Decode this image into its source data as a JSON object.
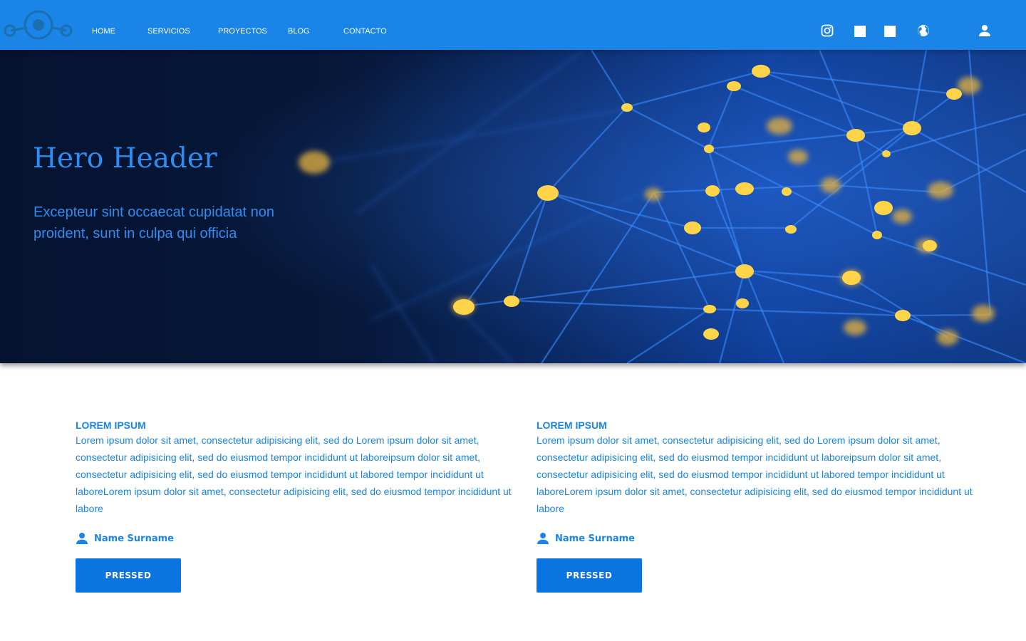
{
  "colors": {
    "navbar": "#1a85e6",
    "accent": "#1a85e6",
    "hero_text": "#2d8df0",
    "button": "#0a74e0",
    "hero_bg": "#06162e"
  },
  "nav": {
    "logo_icon": "network-nodes-logo",
    "links": [
      "HOME",
      "SERVICIOS",
      "PROYECTOS",
      "BLOG",
      "CONTACTO"
    ],
    "icons": [
      "instagram-icon",
      "square-icon",
      "square-icon",
      "globe-icon",
      "user-icon"
    ]
  },
  "hero": {
    "title": "Hero Header",
    "subtitle": "Excepteur sint occaecat cupidatat non proident, sunt in culpa qui officia"
  },
  "cards": [
    {
      "title": "LOREM IPSUM",
      "body": "Lorem ipsum dolor sit amet, consectetur adipisicing elit, sed do Lorem ipsum dolor sit amet, consectetur adipisicing elit, sed do eiusmod tempor incididunt ut laboreipsum dolor sit amet, consectetur adipisicing elit, sed do eiusmod tempor incididunt ut labored tempor incididunt ut laboreLorem ipsum dolor sit amet, consectetur adipisicing elit, sed do eiusmod tempor incididunt ut labore",
      "author": "Name Surname",
      "button_label": "PRESSED"
    },
    {
      "title": "LOREM IPSUM",
      "body": "Lorem ipsum dolor sit amet, consectetur adipisicing elit, sed do Lorem ipsum dolor sit amet, consectetur adipisicing elit, sed do eiusmod tempor incididunt ut laboreipsum dolor sit amet, consectetur adipisicing elit, sed do eiusmod tempor incididunt ut labored tempor incididunt ut laboreLorem ipsum dolor sit amet, consectetur adipisicing elit, sed do eiusmod tempor incididunt ut labore",
      "author": "Name Surname",
      "button_label": "PRESSED"
    }
  ]
}
